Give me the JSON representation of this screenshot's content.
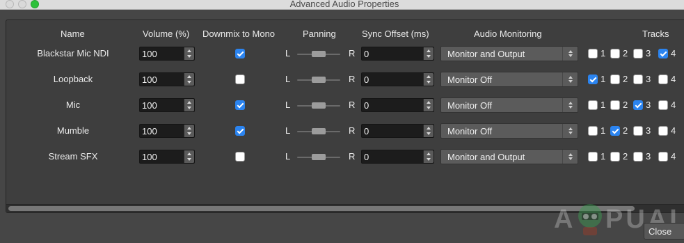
{
  "window": {
    "title": "Advanced Audio Properties"
  },
  "columns": {
    "name": "Name",
    "volume": "Volume (%)",
    "downmix": "Downmix to Mono",
    "panning": "Panning",
    "sync": "Sync Offset (ms)",
    "monitoring": "Audio Monitoring",
    "tracks": "Tracks"
  },
  "pan": {
    "left": "L",
    "right": "R"
  },
  "rows": [
    {
      "name": "Blackstar Mic NDI",
      "volume": "100",
      "downmix": true,
      "sync": "0",
      "monitoring": "Monitor and Output",
      "tracks": [
        false,
        false,
        false,
        true
      ]
    },
    {
      "name": "Loopback",
      "volume": "100",
      "downmix": false,
      "sync": "0",
      "monitoring": "Monitor Off",
      "tracks": [
        true,
        false,
        false,
        false
      ]
    },
    {
      "name": "Mic",
      "volume": "100",
      "downmix": true,
      "sync": "0",
      "monitoring": "Monitor Off",
      "tracks": [
        false,
        false,
        true,
        false
      ]
    },
    {
      "name": "Mumble",
      "volume": "100",
      "downmix": true,
      "sync": "0",
      "monitoring": "Monitor Off",
      "tracks": [
        false,
        true,
        false,
        false
      ]
    },
    {
      "name": "Stream SFX",
      "volume": "100",
      "downmix": false,
      "sync": "0",
      "monitoring": "Monitor and Output",
      "tracks": [
        false,
        false,
        false,
        false
      ]
    }
  ],
  "track_labels": [
    "1",
    "2",
    "3",
    "4"
  ],
  "buttons": {
    "close": "Close"
  },
  "watermark": {
    "text": "APPUALS"
  },
  "colors": {
    "accent": "#2b84f0",
    "panel": "#3e3e3e",
    "background": "#464646"
  }
}
